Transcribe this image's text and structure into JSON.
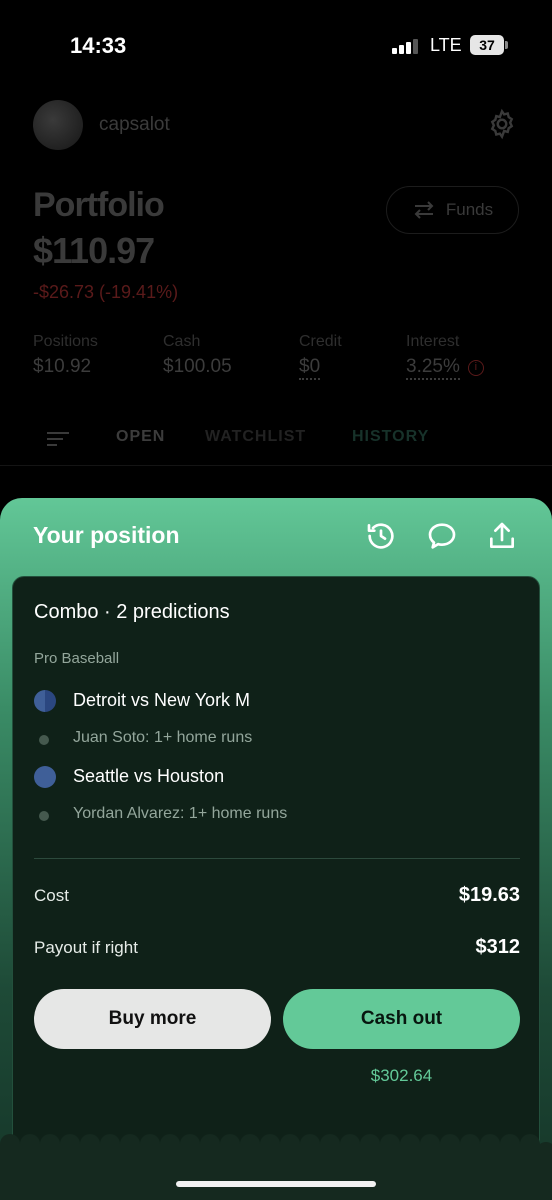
{
  "status_bar": {
    "time": "14:33",
    "network": "LTE",
    "battery": "37"
  },
  "profile": {
    "username": "capsalot"
  },
  "portfolio": {
    "title": "Portfolio",
    "value": "$110.97",
    "change": "-$26.73 (-19.41%)",
    "funds_label": "Funds"
  },
  "stats": [
    {
      "label": "Positions",
      "value": "$10.92"
    },
    {
      "label": "Cash",
      "value": "$100.05"
    },
    {
      "label": "Credit",
      "value": "$0"
    },
    {
      "label": "Interest",
      "value": "3.25%"
    }
  ],
  "tabs": [
    "OPEN",
    "WATCHLIST",
    "HISTORY"
  ],
  "sheet": {
    "title": "Your position",
    "combo_title": "Combo · 2 predictions",
    "league": "Pro Baseball",
    "matches": [
      {
        "name": "Detroit vs New York M",
        "pick": "Juan Soto: 1+ home runs"
      },
      {
        "name": "Seattle vs Houston",
        "pick": "Yordan Alvarez: 1+ home runs"
      }
    ],
    "cost_label": "Cost",
    "cost_value": "$19.63",
    "payout_label": "Payout if right",
    "payout_value": "$312",
    "buy_more_label": "Buy more",
    "cash_out_label": "Cash out",
    "cash_out_value": "$302.64"
  },
  "colors": {
    "accent_green": "#63c998",
    "negative_red": "#5a1a1a",
    "card_bg": "#0f2118"
  },
  "icons": [
    "gear-icon",
    "transfer-icon",
    "info-icon",
    "sort-icon",
    "history-icon",
    "chat-icon",
    "share-icon"
  ]
}
